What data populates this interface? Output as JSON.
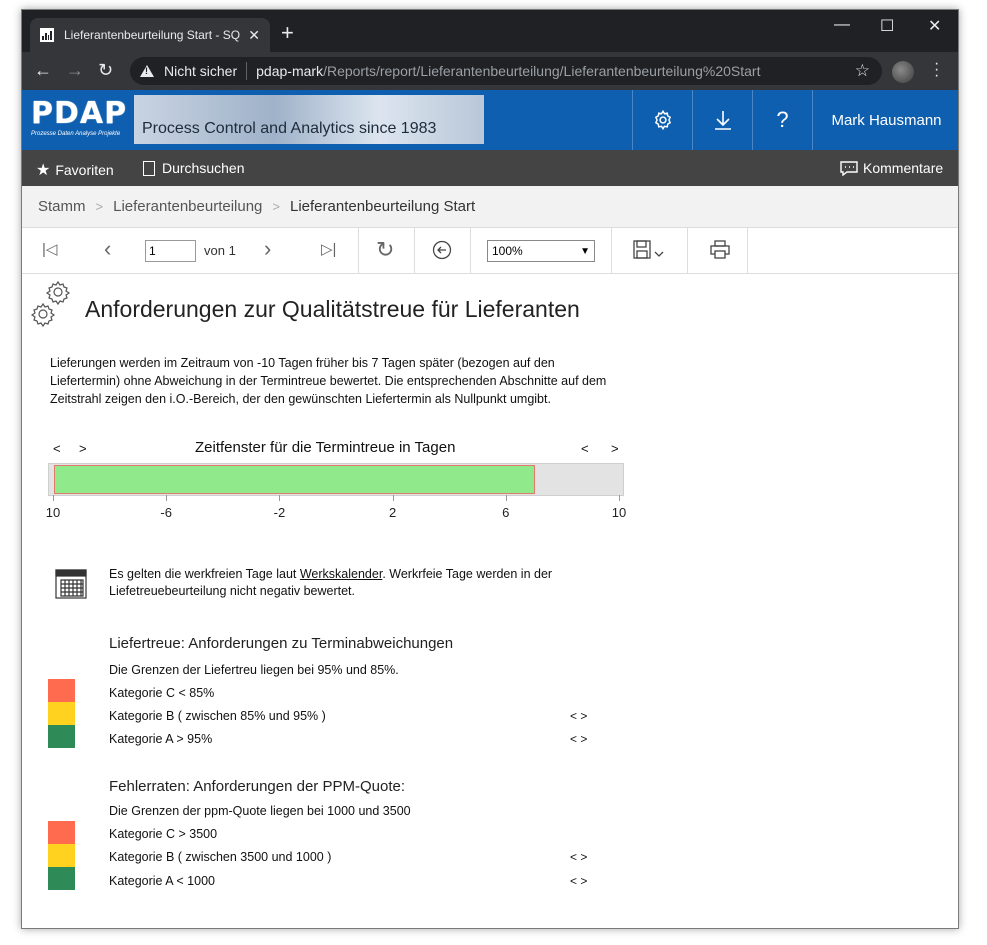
{
  "browser": {
    "tab_title": "Lieferantenbeurteilung Start - SQ",
    "tab_close": "✕",
    "new_tab": "+",
    "security": "Nicht sicher",
    "url_host": "pdap-mark",
    "url_path": "/Reports/report/Lieferantenbeurteilung/Lieferantenbeurteilung%20Start",
    "window_controls": [
      "—",
      "☐",
      "✕"
    ]
  },
  "header": {
    "logo_main": "PDAP",
    "logo_sub": "Prozesse Daten Analyse Projekte",
    "banner_text": "Process Control and Analytics since 1983",
    "icons": [
      "gear-icon",
      "download-icon",
      "help-icon"
    ],
    "help_glyph": "?",
    "user": "Mark Hausmann",
    "accent": "#0f5fb0"
  },
  "toolbar": {
    "favorites": "Favoriten",
    "browse": "Durchsuchen",
    "comments": "Kommentare"
  },
  "breadcrumb": [
    "Stamm",
    "Lieferantenbeurteilung",
    "Lieferantenbeurteilung Start"
  ],
  "report_toolbar": {
    "page_value": "1",
    "page_of": "von 1",
    "zoom": "100%"
  },
  "report": {
    "title": "Anforderungen zur Qualitätstreue für Lieferanten",
    "intro": "Lieferungen werden im Zeitraum von -10 Tagen früher bis 7 Tagen später (bezogen auf den Liefertermin) ohne Abweichung in der Termintreue bewertet. Die entsprechenden Abschnitte auf dem Zeitstrahl zeigen den i.O.-Bereich, der den gewünschten Liefertermin als Nullpunkt umgibt.",
    "timeline": {
      "nav_left": [
        "<",
        ">"
      ],
      "nav_right": [
        "<",
        ">"
      ],
      "title": "Zeitfenster für die Termintreue in Tagen",
      "range_min": -10,
      "range_max": 10,
      "ok_from": -10,
      "ok_to": 7,
      "tick_labels": [
        "10",
        "-6",
        "-2",
        "2",
        "6",
        "10"
      ],
      "tick_values": [
        -10,
        -6,
        -2,
        2,
        6,
        10
      ],
      "colors": {
        "ok": "#90ea8c",
        "track": "#e3e3e3"
      }
    },
    "calendar_text_1": "Es gelten die werkfreien Tage laut ",
    "calendar_link": "Werkskalender",
    "calendar_text_2": ". Werkrfeie Tage werden in der Liefetreuebeurteilung nicht negativ bewertet.",
    "delivery": {
      "heading": "Liefertreue: Anforderungen zu Terminabweichungen",
      "sub": "Die Grenzen der Liefertreu liegen bei 95% und 85%.",
      "categories": [
        {
          "label": "Kategorie C  < 85%",
          "color": "#ff6b4f",
          "nav": ""
        },
        {
          "label": "Kategorie B  ( zwischen 85% und 95% )",
          "color": "#ffd21f",
          "nav": "<    >"
        },
        {
          "label": "Kategorie A  > 95%",
          "color": "#2e8b57",
          "nav": "<    >"
        }
      ]
    },
    "ppm": {
      "heading": "Fehlerraten: Anforderungen der PPM-Quote:",
      "sub": "Die Grenzen der ppm-Quote liegen bei 1000 und 3500",
      "categories": [
        {
          "label": "Kategorie C  > 3500",
          "color": "#ff6b4f",
          "nav": ""
        },
        {
          "label": "Kategorie B  ( zwischen 3500  und 1000 )",
          "color": "#ffd21f",
          "nav": "<    >"
        },
        {
          "label": "Kategorie A  < 1000",
          "color": "#2e8b57",
          "nav": "<    >"
        }
      ]
    }
  }
}
